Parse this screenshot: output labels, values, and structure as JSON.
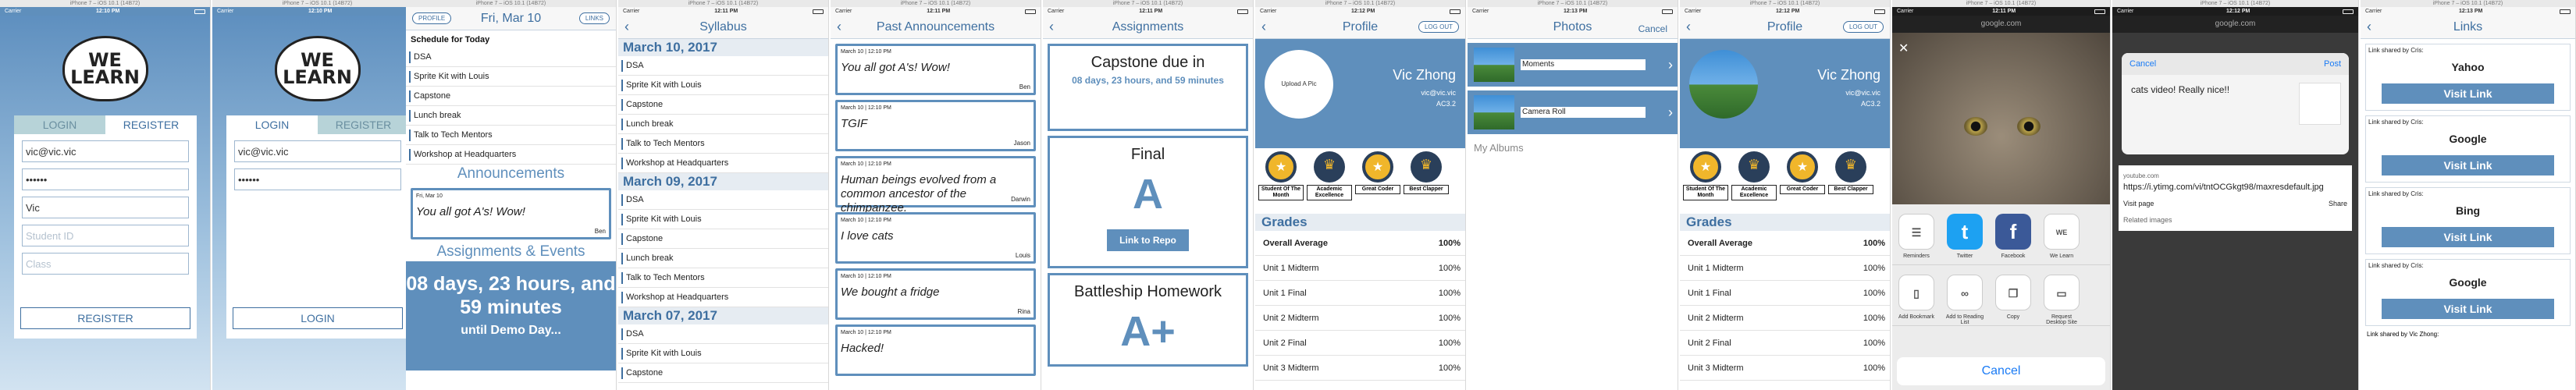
{
  "sim_title": "iPhone 7 – iOS 10.1 (14B72)",
  "carrier": "Carrier",
  "frames": {
    "login1": {
      "time": "12:10 PM",
      "logo": "WE LEARN",
      "tab_login": "LOGIN",
      "tab_register": "REGISTER",
      "email": "vic@vic.vic",
      "password": "••••••",
      "name": "Vic",
      "student_id_ph": "Student ID",
      "class_ph": "Class",
      "button": "REGISTER"
    },
    "login2": {
      "time": "12:10 PM",
      "logo": "WE LEARN",
      "tab_login": "LOGIN",
      "tab_register": "REGISTER",
      "email": "vic@vic.vic",
      "password": "••••••",
      "button": "LOGIN"
    },
    "today": {
      "profile_btn": "PROFILE",
      "title": "Fri, Mar 10",
      "links_btn": "LINKS",
      "schedule_title": "Schedule for Today",
      "items": [
        "DSA",
        "Sprite Kit with Louis",
        "Capstone",
        "Lunch break",
        "Talk to Tech Mentors",
        "Workshop at Headquarters"
      ],
      "ann_head": "Announcements",
      "ann_date": "Fri, Mar 10",
      "ann_body": "You all got A's! Wow!",
      "ann_author": "Ben",
      "ae_head": "Assignments & Events",
      "countdown": "08 days, 23 hours, and 59 minutes",
      "countdown_sub": "until Demo Day..."
    },
    "syllabus": {
      "time": "12:11 PM",
      "title": "Syllabus",
      "sections": [
        {
          "head": "March 10, 2017",
          "items": [
            "DSA",
            "Sprite Kit with Louis",
            "Capstone",
            "Lunch break",
            "Talk to Tech Mentors",
            "Workshop at Headquarters"
          ]
        },
        {
          "head": "March 09, 2017",
          "items": [
            "DSA",
            "Sprite Kit with Louis",
            "Capstone",
            "Lunch break",
            "Talk to Tech Mentors",
            "Workshop at Headquarters"
          ]
        },
        {
          "head": "March 07, 2017",
          "items": [
            "DSA",
            "Sprite Kit with Louis",
            "Capstone"
          ]
        }
      ]
    },
    "announcements": {
      "time": "12:11 PM",
      "title": "Past Announcements",
      "items": [
        {
          "date": "March 10 | 12:10 PM",
          "body": "You all got A's! Wow!",
          "author": "Ben"
        },
        {
          "date": "March 10 | 12:10 PM",
          "body": "TGIF",
          "author": "Jason"
        },
        {
          "date": "March 10 | 12:10 PM",
          "body": "Human beings evolved from a common ancestor of the chimpanzee.",
          "author": "Darwin"
        },
        {
          "date": "March 10 | 12:10 PM",
          "body": "I love cats",
          "author": "Louis"
        },
        {
          "date": "March 10 | 12:10 PM",
          "body": "We bought a fridge",
          "author": "Rina"
        },
        {
          "date": "March 10 | 12:10 PM",
          "body": "Hacked!",
          "author": ""
        }
      ]
    },
    "assignments": {
      "time": "12:11 PM",
      "title": "Assignments",
      "capstone": "Capstone due in",
      "capstone_count": "08 days, 23 hours, and 59 minutes",
      "final": "Final",
      "final_grade": "A",
      "repo_btn": "Link to Repo",
      "battleship": "Battleship Homework",
      "battle_grade": "A+"
    },
    "profile1": {
      "time": "12:12 PM",
      "title": "Profile",
      "logout": "LOG OUT",
      "upload": "Upload A Pic",
      "name": "Vic Zhong",
      "email": "vic@vic.vic",
      "class": "AC3.2",
      "badges": [
        "Student Of The Month",
        "Academic Excellence",
        "Great Coder",
        "Best Clapper"
      ],
      "grades_head": "Grades",
      "grades": [
        {
          "name": "Overall Average",
          "val": "100%"
        },
        {
          "name": "Unit 1 Midterm",
          "val": "100%"
        },
        {
          "name": "Unit 1 Final",
          "val": "100%"
        },
        {
          "name": "Unit 2 Midterm",
          "val": "100%"
        },
        {
          "name": "Unit 2 Final",
          "val": "100%"
        },
        {
          "name": "Unit 3 Midterm",
          "val": "100%"
        }
      ]
    },
    "photos": {
      "time": "12:13 PM",
      "title": "Photos",
      "cancel": "Cancel",
      "albums": [
        "Moments",
        "Camera Roll"
      ],
      "my_albums": "My Albums"
    },
    "profile2": {
      "time": "12:12 PM",
      "title": "Profile",
      "logout": "LOG OUT",
      "name": "Vic Zhong",
      "email": "vic@vic.vic",
      "class": "AC3.2",
      "badges": [
        "Student Of The Month",
        "Academic Excellence",
        "Great Coder",
        "Best Clapper"
      ],
      "grades_head": "Grades",
      "grades": [
        {
          "name": "Overall Average",
          "val": "100%"
        },
        {
          "name": "Unit 1 Midterm",
          "val": "100%"
        },
        {
          "name": "Unit 1 Final",
          "val": "100%"
        },
        {
          "name": "Unit 2 Midterm",
          "val": "100%"
        },
        {
          "name": "Unit 2 Final",
          "val": "100%"
        },
        {
          "name": "Unit 3 Midterm",
          "val": "100%"
        }
      ]
    },
    "share": {
      "time": "12:11 PM",
      "url": "google.com",
      "apps": [
        "Reminders",
        "Twitter",
        "Facebook",
        "We Learn"
      ],
      "actions": [
        "Add Bookmark",
        "Add to Reading List",
        "Copy",
        "Request Desktop Site"
      ],
      "cancel": "Cancel"
    },
    "google": {
      "time": "12:12 PM",
      "url": "google.com",
      "cancel": "Cancel",
      "post": "Post",
      "text": "cats video! Really nice!!",
      "source": "youtube.com",
      "link": "https://i.ytimg.com/vi/tntOCGkgt98/maxresdefault.jpg",
      "visit": "Visit page",
      "share": "Share",
      "related": "Related images"
    },
    "links": {
      "time": "12:13 PM",
      "title": "Links",
      "items": [
        {
          "by": "Link shared by Cris:",
          "name": "Yahoo",
          "btn": "Visit Link"
        },
        {
          "by": "Link shared by Cris:",
          "name": "Google",
          "btn": "Visit Link"
        },
        {
          "by": "Link shared by Cris:",
          "name": "Bing",
          "btn": "Visit Link"
        },
        {
          "by": "Link shared by Cris:",
          "name": "Google",
          "btn": "Visit Link"
        }
      ],
      "last": "Link shared by Vic Zhong:"
    }
  }
}
